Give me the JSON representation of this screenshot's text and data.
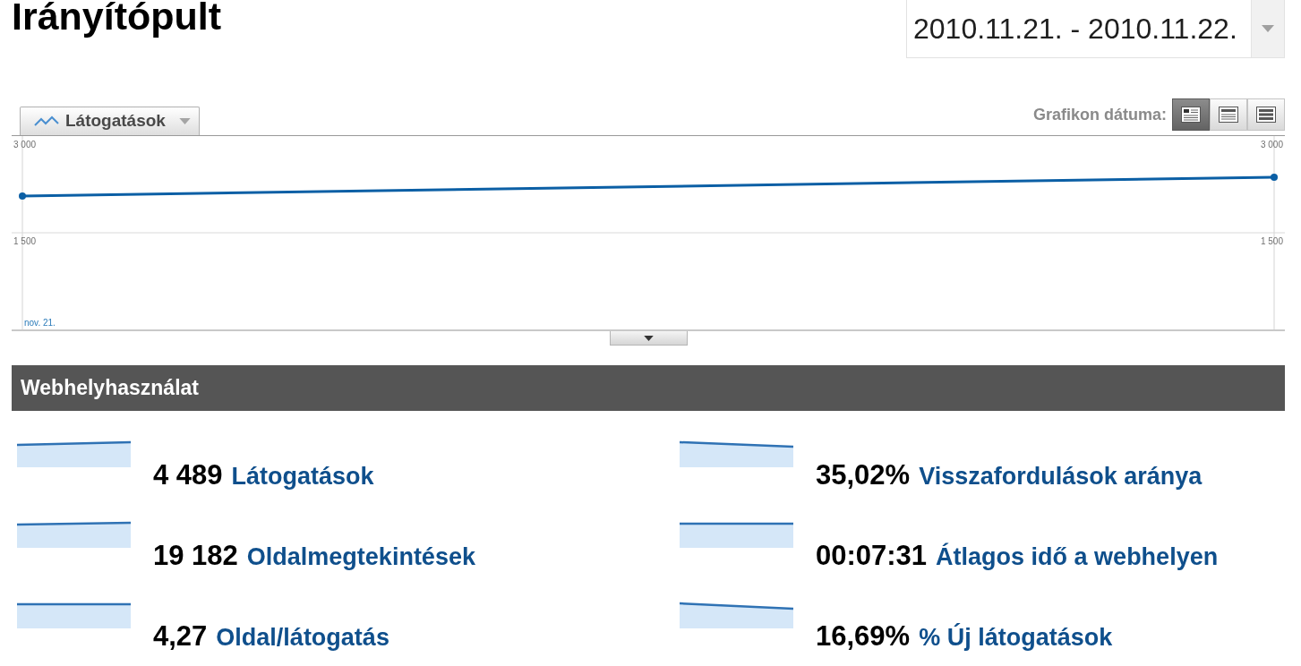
{
  "page": {
    "title": "Irányítópult"
  },
  "date_range": {
    "value": "2010.11.21. - 2010.11.22."
  },
  "chart_toolbar": {
    "metric_dropdown": {
      "label": "Látogatások"
    },
    "graph_by_label": "Grafikon dátuma:",
    "view_buttons": [
      {
        "kind": "day",
        "selected": true
      },
      {
        "kind": "week",
        "selected": false
      },
      {
        "kind": "month",
        "selected": false
      }
    ]
  },
  "chart": {
    "left_axis_labels": [
      "3 000",
      "1 500"
    ],
    "right_axis_labels": [
      "3 000",
      "1 500"
    ],
    "x_axis_labels": [
      "nov. 21."
    ]
  },
  "site_usage": {
    "title": "Webhelyhasználat",
    "columns": [
      {
        "metrics": [
          {
            "value": "4 489",
            "label": "Látogatások"
          },
          {
            "value": "19 182",
            "label": "Oldalmegtekintések"
          },
          {
            "value": "4,27",
            "label": "Oldal/látogatás"
          }
        ]
      },
      {
        "metrics": [
          {
            "value": "35,02%",
            "label": "Visszafordulások aránya"
          },
          {
            "value": "00:07:31",
            "label": "Átlagos idő a webhelyen"
          },
          {
            "value": "16,69%",
            "label": "% Új látogatások"
          }
        ]
      }
    ]
  }
}
